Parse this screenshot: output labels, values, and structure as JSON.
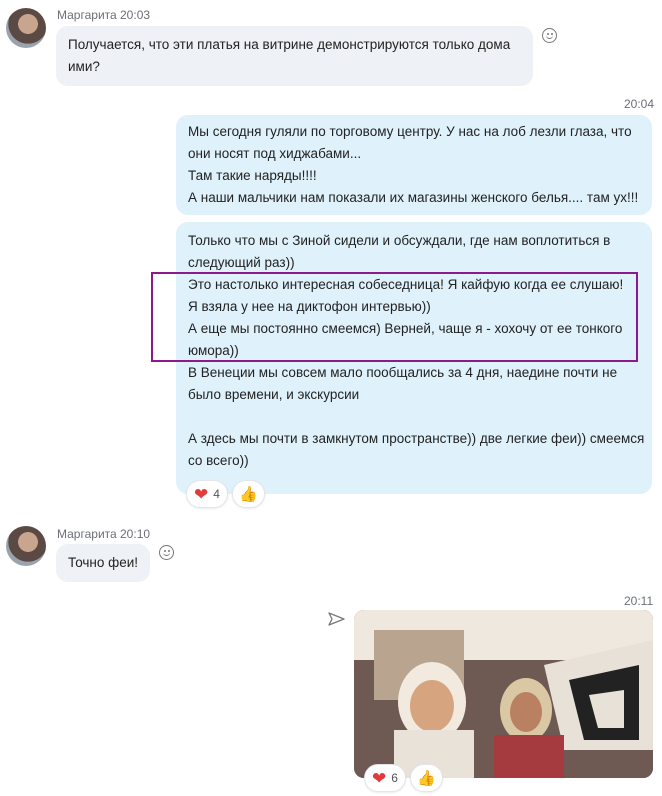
{
  "messages": {
    "m1": {
      "sender": "Маргарита 20:03",
      "lines": [
        "Получается, что эти платья на витрине демонстрируются только дома",
        "ими?"
      ]
    },
    "m2": {
      "time": "20:04",
      "lines": [
        "Мы сегодня гуляли по торговому центру. У нас на лоб лезли глаза, что",
        "они носят под хиджабами...",
        "Там такие наряды!!!!",
        "А наши мальчики нам показали их магазины женского белья.... там ух!!!"
      ]
    },
    "m3": {
      "lines": [
        "Только что мы с Зиной сидели и обсуждали, где нам воплотиться в",
        "следующий раз))",
        "Это настолько интересная собеседница! Я кайфую когда ее слушаю!",
        "Я взяла у нее на диктофон интервью))",
        "А еще мы постоянно смеемся) Верней, чаще я - хохочу от ее тонкого",
        "юмора))",
        "В Венеции мы совсем мало пообщались за 4 дня, наедине почти не",
        "было времени, и экскурсии",
        "",
        "А здесь мы почти в замкнутом пространстве)) две легкие феи)) смеемся",
        "со всего))"
      ],
      "reactions": {
        "heart_count": "4"
      }
    },
    "m4": {
      "sender": "Маргарита 20:10",
      "lines": [
        "Точно феи!"
      ]
    },
    "m5": {
      "time": "20:11",
      "reactions": {
        "heart_count": "6"
      }
    }
  },
  "icons": {
    "emoji_reaction": "smiley-face-icon",
    "heart": "heart-icon",
    "like": "thumbs-up-icon",
    "forward": "send-arrow-icon"
  },
  "colors": {
    "incoming_bubble": "#eef1f5",
    "outgoing_bubble": "#dff1fb",
    "highlight_border": "#8b1a8c"
  }
}
